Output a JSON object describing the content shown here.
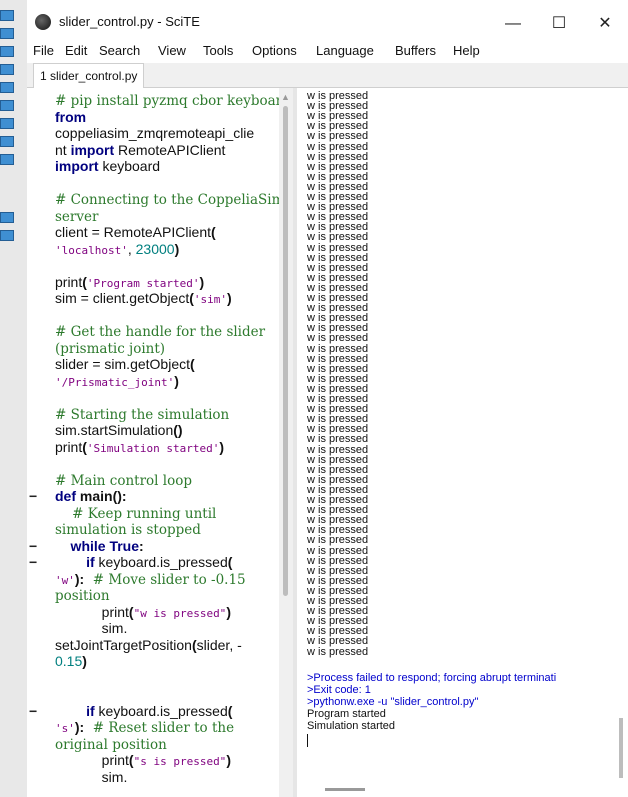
{
  "window": {
    "title": "slider_control.py - SciTE",
    "controls": {
      "minimize": "—",
      "maximize": "☐",
      "close": "✕"
    }
  },
  "menu": [
    "File",
    "Edit",
    "Search",
    "View",
    "Tools",
    "Options",
    "Language",
    "Buffers",
    "Help"
  ],
  "tab": {
    "label": "1 slider_control.py"
  },
  "editor": {
    "lines": [
      {
        "parts": [
          {
            "c": "cm",
            "t": "# pip install pyzmq cbor keyboard"
          }
        ]
      },
      {
        "parts": [
          {
            "c": "kw",
            "t": "from"
          }
        ]
      },
      {
        "parts": [
          {
            "c": "",
            "t": "coppeliasim_zmqremoteapi_clie"
          }
        ]
      },
      {
        "parts": [
          {
            "c": "",
            "t": "nt "
          },
          {
            "c": "kw",
            "t": "import"
          },
          {
            "c": "",
            "t": " RemoteAPIClient"
          }
        ]
      },
      {
        "parts": [
          {
            "c": "kw",
            "t": "import"
          },
          {
            "c": "",
            "t": " keyboard"
          }
        ]
      },
      {
        "parts": []
      },
      {
        "parts": [
          {
            "c": "cm",
            "t": "# Connecting to the CoppeliaSim"
          }
        ]
      },
      {
        "parts": [
          {
            "c": "cm",
            "t": "server"
          }
        ]
      },
      {
        "parts": [
          {
            "c": "",
            "t": "client = RemoteAPIClient"
          },
          {
            "c": "bd",
            "t": "("
          }
        ]
      },
      {
        "parts": [
          {
            "c": "st",
            "t": "'localhost'"
          },
          {
            "c": "",
            "t": ", "
          },
          {
            "c": "nm",
            "t": "23000"
          },
          {
            "c": "bd",
            "t": ")"
          }
        ]
      },
      {
        "parts": []
      },
      {
        "parts": [
          {
            "c": "",
            "t": "print"
          },
          {
            "c": "bd",
            "t": "("
          },
          {
            "c": "st",
            "t": "'Program started'"
          },
          {
            "c": "bd",
            "t": ")"
          }
        ]
      },
      {
        "parts": [
          {
            "c": "",
            "t": "sim = client.getObject"
          },
          {
            "c": "bd",
            "t": "("
          },
          {
            "c": "st",
            "t": "'sim'"
          },
          {
            "c": "bd",
            "t": ")"
          }
        ]
      },
      {
        "parts": []
      },
      {
        "parts": [
          {
            "c": "cm",
            "t": "# Get the handle for the slider"
          }
        ]
      },
      {
        "parts": [
          {
            "c": "cm",
            "t": "(prismatic joint)"
          }
        ]
      },
      {
        "parts": [
          {
            "c": "",
            "t": "slider = sim.getObject"
          },
          {
            "c": "bd",
            "t": "("
          }
        ]
      },
      {
        "parts": [
          {
            "c": "st",
            "t": "'/Prismatic_joint'"
          },
          {
            "c": "bd",
            "t": ")"
          }
        ]
      },
      {
        "parts": []
      },
      {
        "parts": [
          {
            "c": "cm",
            "t": "# Starting the simulation"
          }
        ]
      },
      {
        "parts": [
          {
            "c": "",
            "t": "sim.startSimulation"
          },
          {
            "c": "bd",
            "t": "()"
          }
        ]
      },
      {
        "parts": [
          {
            "c": "",
            "t": "print"
          },
          {
            "c": "bd",
            "t": "("
          },
          {
            "c": "st",
            "t": "'Simulation started'"
          },
          {
            "c": "bd",
            "t": ")"
          }
        ]
      },
      {
        "parts": []
      },
      {
        "parts": [
          {
            "c": "cm",
            "t": "# Main control loop"
          }
        ]
      },
      {
        "parts": [
          {
            "c": "kw",
            "t": "def"
          },
          {
            "c": "",
            "t": " "
          },
          {
            "c": "bd",
            "t": "main"
          },
          {
            "c": "bd",
            "t": "():"
          }
        ]
      },
      {
        "parts": [
          {
            "c": "cm",
            "t": "    # Keep running until"
          }
        ]
      },
      {
        "parts": [
          {
            "c": "cm",
            "t": "simulation is stopped"
          }
        ]
      },
      {
        "parts": [
          {
            "c": "kw",
            "t": "    while True"
          },
          {
            "c": "bd",
            "t": ":"
          }
        ]
      },
      {
        "parts": [
          {
            "c": "kw",
            "t": "        if"
          },
          {
            "c": "",
            "t": " keyboard.is_pressed"
          },
          {
            "c": "bd",
            "t": "("
          }
        ]
      },
      {
        "parts": [
          {
            "c": "st",
            "t": "'w'"
          },
          {
            "c": "bd",
            "t": "):"
          },
          {
            "c": "cm",
            "t": "  # Move slider to -0.15"
          }
        ]
      },
      {
        "parts": [
          {
            "c": "cm",
            "t": "position"
          }
        ]
      },
      {
        "parts": [
          {
            "c": "",
            "t": "            print"
          },
          {
            "c": "bd",
            "t": "("
          },
          {
            "c": "st",
            "t": "\"w is pressed\""
          },
          {
            "c": "bd",
            "t": ")"
          }
        ]
      },
      {
        "parts": [
          {
            "c": "",
            "t": "            sim."
          }
        ]
      },
      {
        "parts": [
          {
            "c": "",
            "t": "setJointTargetPosition"
          },
          {
            "c": "bd",
            "t": "("
          },
          {
            "c": "",
            "t": "slider, -"
          }
        ]
      },
      {
        "parts": [
          {
            "c": "nm",
            "t": "0.15"
          },
          {
            "c": "bd",
            "t": ")"
          }
        ]
      },
      {
        "parts": []
      },
      {
        "parts": []
      },
      {
        "parts": [
          {
            "c": "kw",
            "t": "        if"
          },
          {
            "c": "",
            "t": " keyboard.is_pressed"
          },
          {
            "c": "bd",
            "t": "("
          }
        ]
      },
      {
        "parts": [
          {
            "c": "st",
            "t": "'s'"
          },
          {
            "c": "bd",
            "t": "):"
          },
          {
            "c": "cm",
            "t": "  # Reset slider to the"
          }
        ]
      },
      {
        "parts": [
          {
            "c": "cm",
            "t": "original position"
          }
        ]
      },
      {
        "parts": [
          {
            "c": "",
            "t": "            print"
          },
          {
            "c": "bd",
            "t": "("
          },
          {
            "c": "st",
            "t": "\"s is pressed\""
          },
          {
            "c": "bd",
            "t": ")"
          }
        ]
      },
      {
        "parts": [
          {
            "c": "",
            "t": "            sim."
          }
        ]
      }
    ],
    "fold_markers": [
      {
        "line": 24,
        "glyph": "−"
      },
      {
        "line": 27,
        "glyph": "−"
      },
      {
        "line": 28,
        "glyph": "−"
      },
      {
        "line": 37,
        "glyph": "−"
      }
    ]
  },
  "output": {
    "repeat_line": "w is pressed",
    "repeat_count": 56,
    "messages": [
      {
        "text": ">Process failed to respond; forcing abrupt terminati",
        "blue": true
      },
      {
        "text": ">Exit code: 1",
        "blue": true
      },
      {
        "text": ">pythonw.exe -u \"slider_control.py\"",
        "blue": true
      },
      {
        "text": "Program started",
        "blue": false
      },
      {
        "text": "Simulation started",
        "blue": false
      }
    ]
  }
}
